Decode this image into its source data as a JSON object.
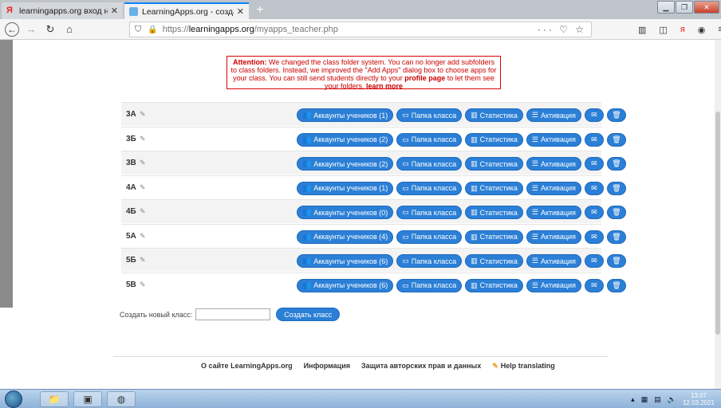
{
  "browser": {
    "tabs": [
      {
        "title": "learningapps.org вход на стра",
        "active": false
      },
      {
        "title": "LearningApps.org - создание",
        "active": true
      }
    ],
    "url": {
      "prefix": "https://",
      "domain": "learningapps.org",
      "path": "/myapps_teacher.php"
    },
    "url_tools": "··· ♡ ☆"
  },
  "notice": {
    "attention": "Attention:",
    "text1": " We changed the class folder system. You can no longer add subfolders to class folders. Instead, we improved the \"Add Apps\" dialog box to choose apps for your class. You can still send students directly to your ",
    "profile_link": "profile page",
    "text2": " to let them see your folders. ",
    "learn_more": "learn more"
  },
  "buttons": {
    "folder": "Папка класса",
    "stats": "Статистика",
    "activation": "Активация"
  },
  "classes": [
    {
      "name": "3А",
      "accounts": "Аккаунты учеников (1)"
    },
    {
      "name": "3Б",
      "accounts": "Аккаунты учеников (2)"
    },
    {
      "name": "3В",
      "accounts": "Аккаунты учеников (2)"
    },
    {
      "name": "4А",
      "accounts": "Аккаунты учеников (1)"
    },
    {
      "name": "4Б",
      "accounts": "Аккаунты учеников (0)"
    },
    {
      "name": "5А",
      "accounts": "Аккаунты учеников (4)"
    },
    {
      "name": "5Б",
      "accounts": "Аккаунты учеников (6)"
    },
    {
      "name": "5В",
      "accounts": "Аккаунты учеников (6)"
    }
  ],
  "create": {
    "label": "Создать новый класс:",
    "input_value": "",
    "button": "Создать класс"
  },
  "footer": {
    "about": "О сайте LearningApps.org",
    "info": "Информация",
    "copyright": "Защита авторских прав и данных",
    "translate": "Help translating"
  },
  "taskbar": {
    "time": "13:07",
    "date": "12.03.2021"
  }
}
